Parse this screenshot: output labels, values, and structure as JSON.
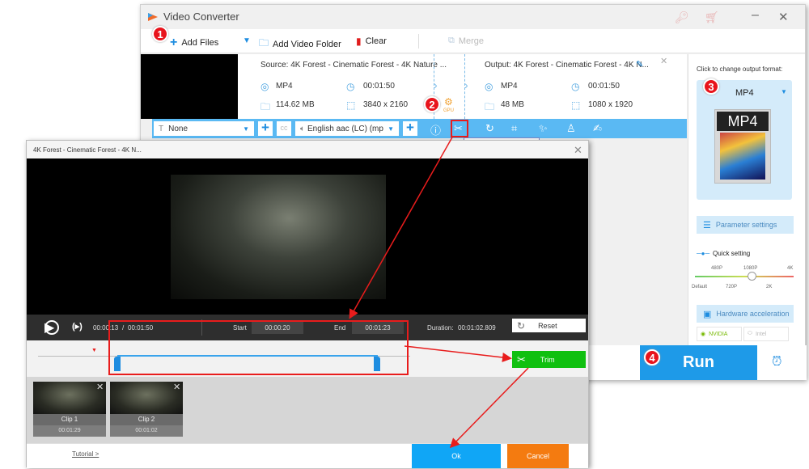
{
  "app": {
    "title": "Video Converter"
  },
  "toolbar": {
    "add_files": "Add Files",
    "add_folder": "Add Video Folder",
    "clear": "Clear",
    "merge": "Merge"
  },
  "file": {
    "source_title": "Source: 4K Forest - Cinematic Forest - 4K Nature ...",
    "output_title": "Output: 4K Forest - Cinematic Forest - 4K N...",
    "source": {
      "format": "MP4",
      "duration": "00:01:50",
      "size": "114.62 MB",
      "resolution": "3840 x 2160"
    },
    "output": {
      "format": "MP4",
      "duration": "00:01:50",
      "size": "48 MB",
      "resolution": "1080 x 1920"
    },
    "gpu_label": "GPU",
    "subtitle": "None",
    "audio": "English aac (LC) (mp"
  },
  "panel": {
    "change_format_label": "Click to change output format:",
    "format": "MP4",
    "format_icon_text": "MP4",
    "param_settings": "Parameter settings",
    "quick_setting": "Quick setting",
    "quality_top": [
      "480P",
      "1080P",
      "4K"
    ],
    "quality_bottom": [
      "Default",
      "720P",
      "2K"
    ],
    "quality_selected": "1080P",
    "hw_accel": "Hardware acceleration",
    "nvidia": "NVIDIA",
    "intel": "Intel"
  },
  "run": {
    "label": "Run"
  },
  "annotations": {
    "b1": "1",
    "b2": "2",
    "b3": "3",
    "b4": "4",
    "trim_callout": "Trim"
  },
  "dialog": {
    "title": "4K Forest - Cinematic Forest - 4K N...",
    "current_time": "00:00:13",
    "total_time": "00:01:50",
    "time_sep": "/",
    "start_label": "Start",
    "start_value": "00:00:20",
    "end_label": "End",
    "end_value": "00:01:23",
    "duration_label": "Duration:",
    "duration_value": "00:01:02.809",
    "reset": "Reset",
    "trim": "Trim",
    "clips": [
      {
        "name": "Clip 1",
        "duration": "00:01:29"
      },
      {
        "name": "Clip 2",
        "duration": "00:01:02"
      }
    ],
    "tutorial": "Tutorial >",
    "ok": "Ok",
    "cancel": "Cancel"
  },
  "colors": {
    "accent": "#1e9ae8",
    "trim_green": "#10c010",
    "cancel_orange": "#f47b10",
    "annotation_red": "#e81c1c"
  }
}
